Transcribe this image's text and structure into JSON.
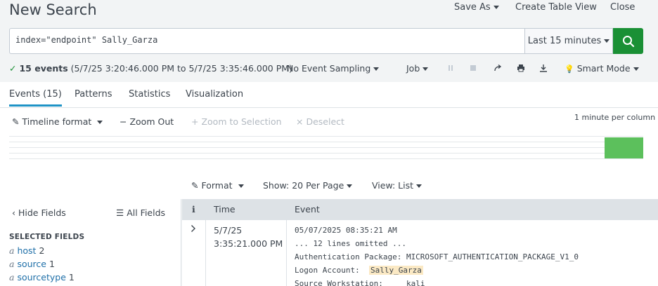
{
  "header": {
    "title": "New Search",
    "save_as": "Save As",
    "create_table_view": "Create Table View",
    "close": "Close"
  },
  "search": {
    "query": "index=\"endpoint\" Sally_Garza",
    "time_range": "Last 15 minutes"
  },
  "status": {
    "event_count": "15 events",
    "range_text": "(5/7/25 3:20:46.000 PM to 5/7/25 3:35:46.000 PM)",
    "sampling": "No Event Sampling",
    "job": "Job",
    "mode": "Smart Mode"
  },
  "tabs": [
    {
      "label": "Events (15)",
      "active": true
    },
    {
      "label": "Patterns"
    },
    {
      "label": "Statistics"
    },
    {
      "label": "Visualization"
    }
  ],
  "timeline": {
    "format": "Timeline format",
    "zoom_out": "Zoom Out",
    "zoom_selection": "Zoom to Selection",
    "deselect": "Deselect",
    "scale": "1 minute per column"
  },
  "results_controls": {
    "format": "Format",
    "per_page": "Show: 20 Per Page",
    "view": "View: List"
  },
  "fields": {
    "hide": "Hide Fields",
    "all": "All Fields",
    "selected_title": "SELECTED FIELDS",
    "selected": [
      {
        "type": "a",
        "name": "host",
        "count": "2"
      },
      {
        "type": "a",
        "name": "source",
        "count": "1"
      },
      {
        "type": "a",
        "name": "sourcetype",
        "count": "1"
      }
    ]
  },
  "table": {
    "col_info": "i",
    "col_time": "Time",
    "col_event": "Event"
  },
  "event": {
    "date": "5/7/25",
    "time": "3:35:21.000 PM",
    "line1": "05/07/2025 08:35:21 AM",
    "line2": "... 12 lines omitted ...",
    "line3": "Authentication Package: MICROSOFT_AUTHENTICATION_PACKAGE_V1_0",
    "line4_label": "Logon Account:  ",
    "line4_value": "Sally_Garza",
    "line5_label": "Source Workstation:     ",
    "line5_value": "kali"
  },
  "colors": {
    "accent_green": "#1a9035",
    "tab_accent": "#1e93c6",
    "timeline_bar": "#5cc05c",
    "highlight": "#fbe9c4"
  }
}
